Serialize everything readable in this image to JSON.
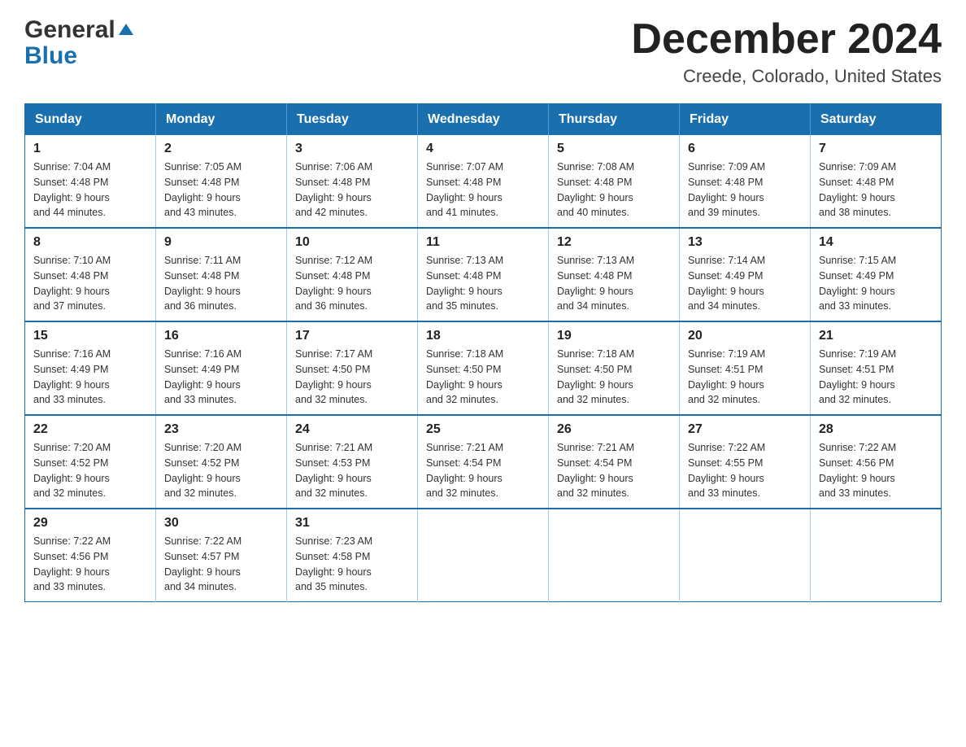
{
  "header": {
    "logo_general": "General",
    "logo_blue": "Blue",
    "title": "December 2024",
    "subtitle": "Creede, Colorado, United States"
  },
  "calendar": {
    "days_of_week": [
      "Sunday",
      "Monday",
      "Tuesday",
      "Wednesday",
      "Thursday",
      "Friday",
      "Saturday"
    ],
    "weeks": [
      [
        {
          "day": "1",
          "sunrise": "7:04 AM",
          "sunset": "4:48 PM",
          "daylight": "9 hours and 44 minutes."
        },
        {
          "day": "2",
          "sunrise": "7:05 AM",
          "sunset": "4:48 PM",
          "daylight": "9 hours and 43 minutes."
        },
        {
          "day": "3",
          "sunrise": "7:06 AM",
          "sunset": "4:48 PM",
          "daylight": "9 hours and 42 minutes."
        },
        {
          "day": "4",
          "sunrise": "7:07 AM",
          "sunset": "4:48 PM",
          "daylight": "9 hours and 41 minutes."
        },
        {
          "day": "5",
          "sunrise": "7:08 AM",
          "sunset": "4:48 PM",
          "daylight": "9 hours and 40 minutes."
        },
        {
          "day": "6",
          "sunrise": "7:09 AM",
          "sunset": "4:48 PM",
          "daylight": "9 hours and 39 minutes."
        },
        {
          "day": "7",
          "sunrise": "7:09 AM",
          "sunset": "4:48 PM",
          "daylight": "9 hours and 38 minutes."
        }
      ],
      [
        {
          "day": "8",
          "sunrise": "7:10 AM",
          "sunset": "4:48 PM",
          "daylight": "9 hours and 37 minutes."
        },
        {
          "day": "9",
          "sunrise": "7:11 AM",
          "sunset": "4:48 PM",
          "daylight": "9 hours and 36 minutes."
        },
        {
          "day": "10",
          "sunrise": "7:12 AM",
          "sunset": "4:48 PM",
          "daylight": "9 hours and 36 minutes."
        },
        {
          "day": "11",
          "sunrise": "7:13 AM",
          "sunset": "4:48 PM",
          "daylight": "9 hours and 35 minutes."
        },
        {
          "day": "12",
          "sunrise": "7:13 AM",
          "sunset": "4:48 PM",
          "daylight": "9 hours and 34 minutes."
        },
        {
          "day": "13",
          "sunrise": "7:14 AM",
          "sunset": "4:49 PM",
          "daylight": "9 hours and 34 minutes."
        },
        {
          "day": "14",
          "sunrise": "7:15 AM",
          "sunset": "4:49 PM",
          "daylight": "9 hours and 33 minutes."
        }
      ],
      [
        {
          "day": "15",
          "sunrise": "7:16 AM",
          "sunset": "4:49 PM",
          "daylight": "9 hours and 33 minutes."
        },
        {
          "day": "16",
          "sunrise": "7:16 AM",
          "sunset": "4:49 PM",
          "daylight": "9 hours and 33 minutes."
        },
        {
          "day": "17",
          "sunrise": "7:17 AM",
          "sunset": "4:50 PM",
          "daylight": "9 hours and 32 minutes."
        },
        {
          "day": "18",
          "sunrise": "7:18 AM",
          "sunset": "4:50 PM",
          "daylight": "9 hours and 32 minutes."
        },
        {
          "day": "19",
          "sunrise": "7:18 AM",
          "sunset": "4:50 PM",
          "daylight": "9 hours and 32 minutes."
        },
        {
          "day": "20",
          "sunrise": "7:19 AM",
          "sunset": "4:51 PM",
          "daylight": "9 hours and 32 minutes."
        },
        {
          "day": "21",
          "sunrise": "7:19 AM",
          "sunset": "4:51 PM",
          "daylight": "9 hours and 32 minutes."
        }
      ],
      [
        {
          "day": "22",
          "sunrise": "7:20 AM",
          "sunset": "4:52 PM",
          "daylight": "9 hours and 32 minutes."
        },
        {
          "day": "23",
          "sunrise": "7:20 AM",
          "sunset": "4:52 PM",
          "daylight": "9 hours and 32 minutes."
        },
        {
          "day": "24",
          "sunrise": "7:21 AM",
          "sunset": "4:53 PM",
          "daylight": "9 hours and 32 minutes."
        },
        {
          "day": "25",
          "sunrise": "7:21 AM",
          "sunset": "4:54 PM",
          "daylight": "9 hours and 32 minutes."
        },
        {
          "day": "26",
          "sunrise": "7:21 AM",
          "sunset": "4:54 PM",
          "daylight": "9 hours and 32 minutes."
        },
        {
          "day": "27",
          "sunrise": "7:22 AM",
          "sunset": "4:55 PM",
          "daylight": "9 hours and 33 minutes."
        },
        {
          "day": "28",
          "sunrise": "7:22 AM",
          "sunset": "4:56 PM",
          "daylight": "9 hours and 33 minutes."
        }
      ],
      [
        {
          "day": "29",
          "sunrise": "7:22 AM",
          "sunset": "4:56 PM",
          "daylight": "9 hours and 33 minutes."
        },
        {
          "day": "30",
          "sunrise": "7:22 AM",
          "sunset": "4:57 PM",
          "daylight": "9 hours and 34 minutes."
        },
        {
          "day": "31",
          "sunrise": "7:23 AM",
          "sunset": "4:58 PM",
          "daylight": "9 hours and 35 minutes."
        },
        null,
        null,
        null,
        null
      ]
    ]
  }
}
